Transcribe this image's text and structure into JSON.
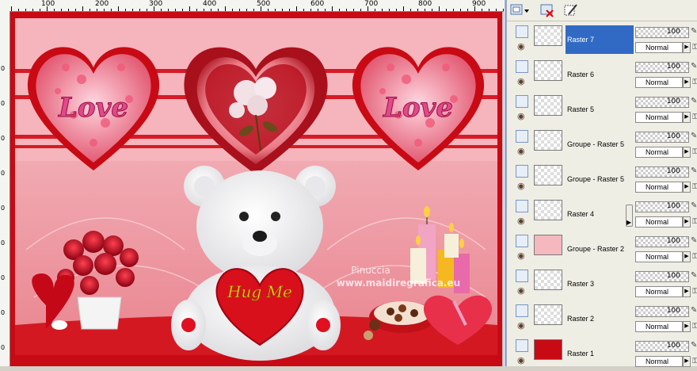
{
  "ruler": {
    "top_labels": [
      "100",
      "200",
      "300",
      "400",
      "500",
      "600",
      "700",
      "800",
      "900"
    ],
    "left_labels": [
      "0",
      "0",
      "0",
      "0",
      "0",
      "0",
      "0",
      "0",
      "0"
    ]
  },
  "artwork": {
    "watermark_line1": "Pinuccia",
    "watermark_line2": "www.maidiregrafica.eu",
    "heart_text_left": "Love",
    "heart_text_right": "Love",
    "bear_heart_text": "Hug Me"
  },
  "layers": [
    {
      "name": "Raster 7",
      "opacity": "100",
      "blend": "Normal",
      "selected": true,
      "thumb": "raster7"
    },
    {
      "name": "Raster 6",
      "opacity": "100",
      "blend": "Normal",
      "selected": false,
      "thumb": "raster6"
    },
    {
      "name": "Raster 5",
      "opacity": "100",
      "blend": "Normal",
      "selected": false,
      "thumb": "raster5"
    },
    {
      "name": "Groupe - Raster 5",
      "opacity": "100",
      "blend": "Normal",
      "selected": false,
      "thumb": "group5a"
    },
    {
      "name": "Groupe - Raster 5",
      "opacity": "100",
      "blend": "Normal",
      "selected": false,
      "thumb": "group5b"
    },
    {
      "name": "Raster 4",
      "opacity": "100",
      "blend": "Normal",
      "selected": false,
      "thumb": "raster4"
    },
    {
      "name": "Groupe - Raster 2",
      "opacity": "100",
      "blend": "Normal",
      "selected": false,
      "thumb": "group2"
    },
    {
      "name": "Raster 3",
      "opacity": "100",
      "blend": "Normal",
      "selected": false,
      "thumb": "raster3"
    },
    {
      "name": "Raster 2",
      "opacity": "100",
      "blend": "Normal",
      "selected": false,
      "thumb": "raster2"
    },
    {
      "name": "Raster 1",
      "opacity": "100",
      "blend": "Normal",
      "selected": false,
      "thumb": "raster1"
    }
  ],
  "icons": {
    "toolbar": [
      "new-layer-icon",
      "dropdown-arrow-icon",
      "delete-layer-icon",
      "edit-mask-icon"
    ],
    "row": [
      "layer-toggle-icon",
      "visibility-eye-icon",
      "edit-pen-icon",
      "lock-icon",
      "blend-dropdown-arrow-icon"
    ]
  },
  "colors": {
    "selection": "#316ac5",
    "canvas_red": "#c80a14",
    "canvas_pink": "#f4b8be",
    "panel": "#efeee5"
  }
}
